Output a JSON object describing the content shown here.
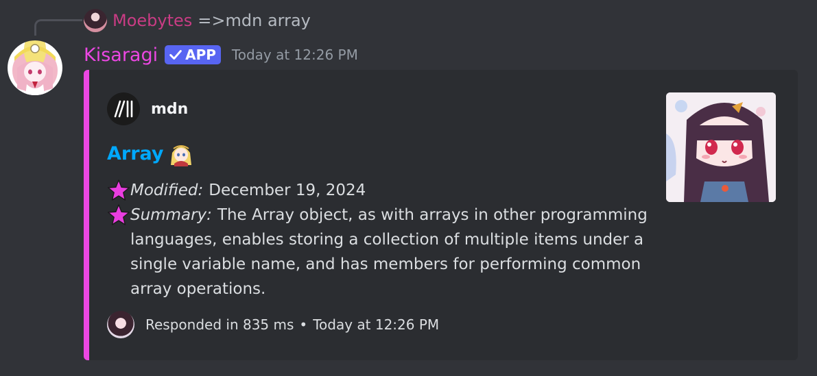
{
  "reply": {
    "author": "Moebytes",
    "content": "=>mdn array"
  },
  "message": {
    "author": "Kisaragi",
    "badge": "APP",
    "timestamp": "Today at 12:26 PM"
  },
  "embed": {
    "author_name": "mdn",
    "title": "Array",
    "fields": [
      {
        "label": "Modified:",
        "value": "December 19, 2024"
      },
      {
        "label": "Summary:",
        "value": "The Array object, as with arrays in other programming languages, enables storing a collection of multiple items under a single variable name, and has members for performing common array operations."
      }
    ],
    "footer_text": "Responded in 835 ms",
    "footer_separator": "•",
    "footer_timestamp": "Today at 12:26 PM"
  },
  "colors": {
    "background": "#313338",
    "embed_background": "#2b2d31",
    "embed_accent": "#ec47e3",
    "author_name": "#ec47e3",
    "reply_name": "#c93c84",
    "link": "#00a8fc",
    "app_badge": "#5865f2",
    "star": "#e93ee0"
  },
  "icons": {
    "reply_avatar": "moebytes-avatar",
    "main_avatar": "kisaragi-avatar",
    "badge_check": "check-icon",
    "embed_author": "mdn-logo-icon",
    "title_emoji": "chibi-emoji-icon",
    "field_bullet": "star-icon",
    "thumbnail": "anime-girl-thumbnail",
    "footer_icon": "footer-avatar"
  }
}
